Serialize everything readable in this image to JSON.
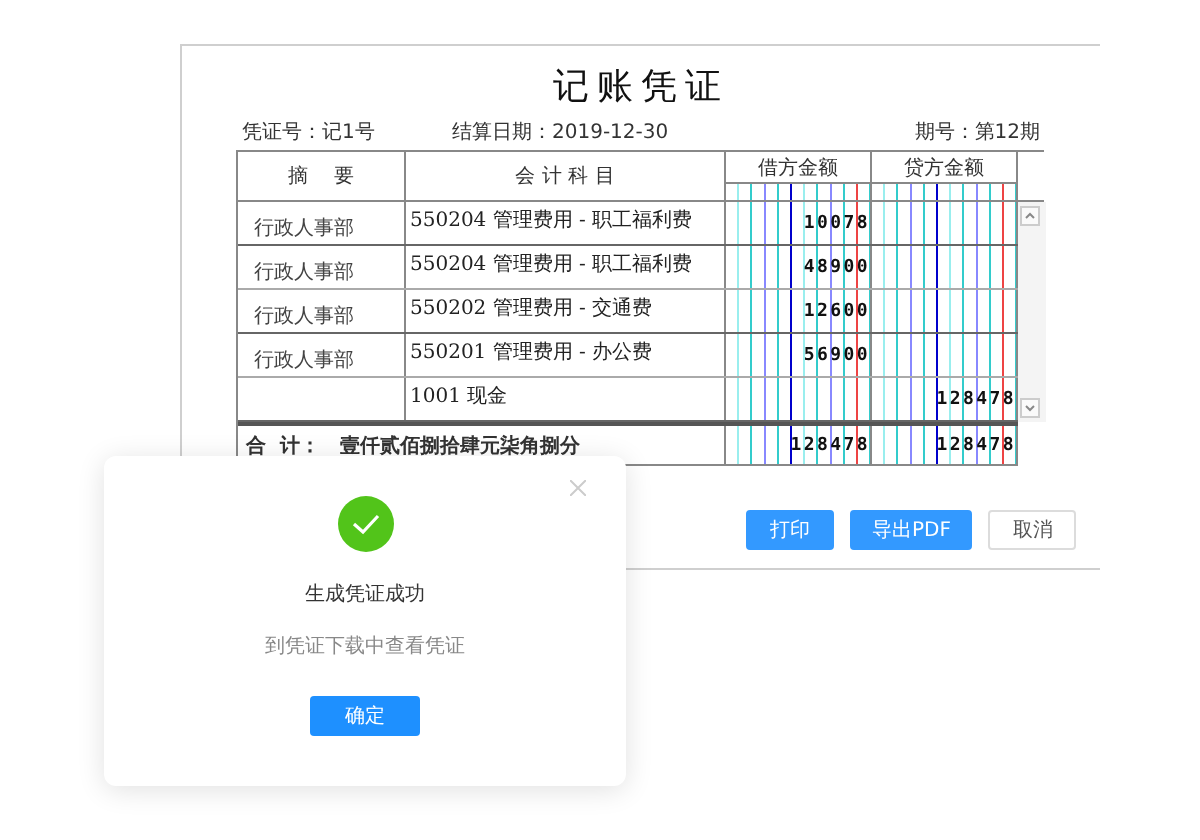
{
  "voucher": {
    "title": "记账凭证",
    "number": "凭证号：记1号",
    "date": "结算日期：2019-12-30",
    "period": "期号：第12期",
    "columns": {
      "summary": "摘    要",
      "account": "会 计 科 目",
      "debit": "借方金额",
      "credit": "贷方金额"
    },
    "rows": [
      {
        "summary": "行政人事部",
        "account": "550204 管理费用 - 职工福利费",
        "debit": "10078",
        "credit": ""
      },
      {
        "summary": "行政人事部",
        "account": "550204 管理费用 - 职工福利费",
        "debit": "48900",
        "credit": ""
      },
      {
        "summary": "行政人事部",
        "account": "550202 管理费用 - 交通费",
        "debit": "12600",
        "credit": ""
      },
      {
        "summary": "行政人事部",
        "account": "550201 管理费用 - 办公费",
        "debit": "56900",
        "credit": ""
      },
      {
        "summary": "",
        "account": "1001 现金",
        "debit": "",
        "credit": "128478"
      }
    ],
    "total": {
      "label": "合  计：",
      "words": "壹仟贰佰捌拾肆元柒角捌分",
      "debit": "128478",
      "credit": "128478"
    },
    "buttons": [
      {
        "label": "打印",
        "kind": "primary"
      },
      {
        "label": "导出PDF",
        "kind": "primary"
      },
      {
        "label": "取消",
        "kind": "plain"
      }
    ]
  },
  "dialog": {
    "title": "生成凭证成功",
    "message": "到凭证下载中查看凭证",
    "button": "确定"
  }
}
